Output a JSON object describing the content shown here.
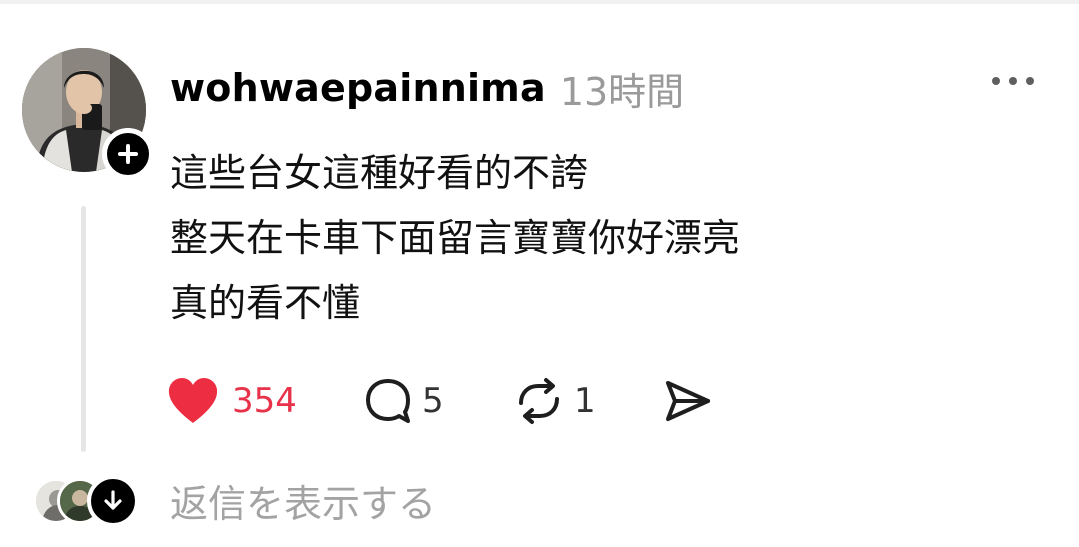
{
  "post": {
    "author": {
      "username": "wohwaepainnima",
      "avatar_icon": "profile-photo",
      "follow_icon": "plus-icon"
    },
    "timestamp": "13時間",
    "more_icon": "more-horizontal-icon",
    "text_lines": [
      "這些台女這種好看的不誇",
      "整天在卡車下面留言寶寶你好漂亮",
      "真的看不懂"
    ],
    "actions": {
      "like": {
        "icon": "heart-filled-icon",
        "count": "354",
        "color": "#e8324a"
      },
      "comment": {
        "icon": "comment-icon",
        "count": "5"
      },
      "repost": {
        "icon": "repost-icon",
        "count": "1"
      },
      "share": {
        "icon": "send-icon"
      }
    }
  },
  "replies": {
    "label": "返信を表示する",
    "expand_icon": "arrow-down-icon"
  }
}
